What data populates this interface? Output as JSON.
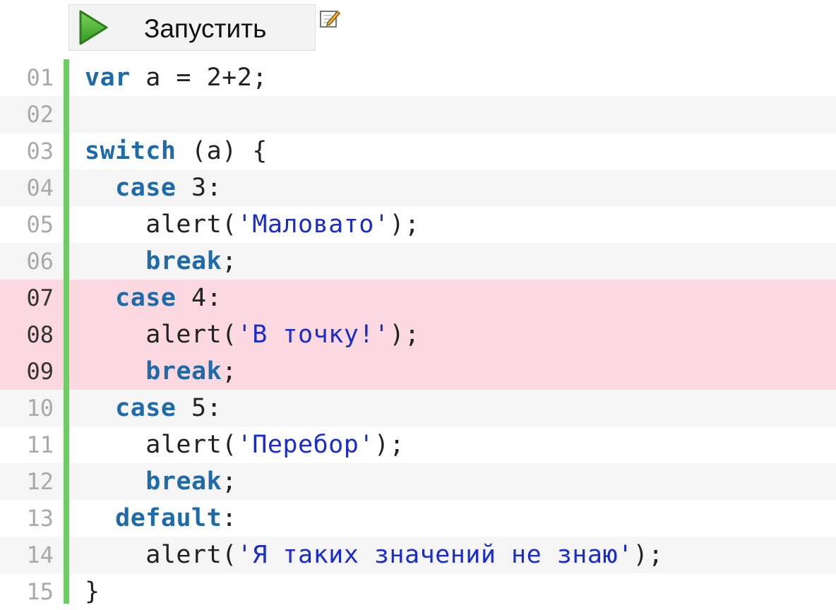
{
  "toolbar": {
    "run_label": "Запустить",
    "run_icon": "play-icon",
    "edit_icon": "edit-icon"
  },
  "colors": {
    "gutter_accent": "#6acf5f",
    "highlight": "#fcd8e0",
    "keyword": "#1f6aa8",
    "string": "#1a2ccb"
  },
  "code": {
    "highlighted_lines": [
      "07",
      "08",
      "09"
    ],
    "lines": [
      {
        "no": "01",
        "tokens": [
          {
            "t": "kw",
            "v": "var"
          },
          {
            "t": "plain",
            "v": " a = 2+2;"
          }
        ]
      },
      {
        "no": "02",
        "tokens": []
      },
      {
        "no": "03",
        "tokens": [
          {
            "t": "kw",
            "v": "switch"
          },
          {
            "t": "plain",
            "v": " (a) {"
          }
        ]
      },
      {
        "no": "04",
        "tokens": [
          {
            "t": "plain",
            "v": "  "
          },
          {
            "t": "kw",
            "v": "case"
          },
          {
            "t": "plain",
            "v": " 3:"
          }
        ]
      },
      {
        "no": "05",
        "tokens": [
          {
            "t": "plain",
            "v": "    alert("
          },
          {
            "t": "str",
            "v": "'Маловато'"
          },
          {
            "t": "plain",
            "v": ");"
          }
        ]
      },
      {
        "no": "06",
        "tokens": [
          {
            "t": "plain",
            "v": "    "
          },
          {
            "t": "kw",
            "v": "break"
          },
          {
            "t": "plain",
            "v": ";"
          }
        ]
      },
      {
        "no": "07",
        "tokens": [
          {
            "t": "plain",
            "v": "  "
          },
          {
            "t": "kw",
            "v": "case"
          },
          {
            "t": "plain",
            "v": " 4:"
          }
        ]
      },
      {
        "no": "08",
        "tokens": [
          {
            "t": "plain",
            "v": "    alert("
          },
          {
            "t": "str",
            "v": "'В точку!'"
          },
          {
            "t": "plain",
            "v": ");"
          }
        ]
      },
      {
        "no": "09",
        "tokens": [
          {
            "t": "plain",
            "v": "    "
          },
          {
            "t": "kw",
            "v": "break"
          },
          {
            "t": "plain",
            "v": ";"
          }
        ]
      },
      {
        "no": "10",
        "tokens": [
          {
            "t": "plain",
            "v": "  "
          },
          {
            "t": "kw",
            "v": "case"
          },
          {
            "t": "plain",
            "v": " 5:"
          }
        ]
      },
      {
        "no": "11",
        "tokens": [
          {
            "t": "plain",
            "v": "    alert("
          },
          {
            "t": "str",
            "v": "'Перебор'"
          },
          {
            "t": "plain",
            "v": ");"
          }
        ]
      },
      {
        "no": "12",
        "tokens": [
          {
            "t": "plain",
            "v": "    "
          },
          {
            "t": "kw",
            "v": "break"
          },
          {
            "t": "plain",
            "v": ";"
          }
        ]
      },
      {
        "no": "13",
        "tokens": [
          {
            "t": "plain",
            "v": "  "
          },
          {
            "t": "kw",
            "v": "default"
          },
          {
            "t": "plain",
            "v": ":"
          }
        ]
      },
      {
        "no": "14",
        "tokens": [
          {
            "t": "plain",
            "v": "    alert("
          },
          {
            "t": "str",
            "v": "'Я таких значений не знаю'"
          },
          {
            "t": "plain",
            "v": ");"
          }
        ]
      },
      {
        "no": "15",
        "tokens": [
          {
            "t": "plain",
            "v": "}"
          }
        ]
      }
    ]
  }
}
